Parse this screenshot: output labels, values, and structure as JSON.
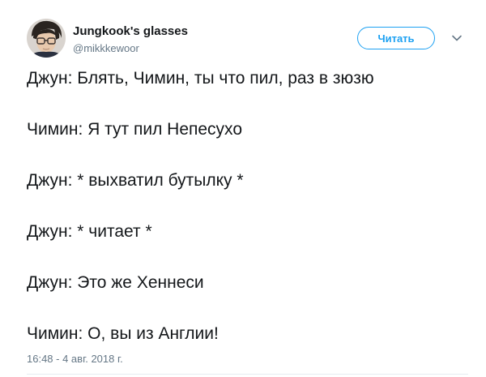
{
  "author": {
    "display_name": "Jungkook's glasses",
    "username": "@mikkkewoor",
    "avatar_icon": "avatar-photo-icon"
  },
  "follow_button": {
    "label": "Читать",
    "color": "#1da1f2"
  },
  "menu": {
    "icon": "chevron-down-icon"
  },
  "tweet": {
    "lines": [
      "Джун: Блять, Чимин, ты что пил, раз в зюзю",
      "Чимин: Я тут пил Непесухо",
      "Джун: * выхватил бутылку *",
      "Джун: * читает *",
      "Джун: Это же Хеннеси",
      "Чимин: О, вы из Англии!"
    ],
    "timestamp": "16:48 - 4 авг. 2018 г."
  }
}
